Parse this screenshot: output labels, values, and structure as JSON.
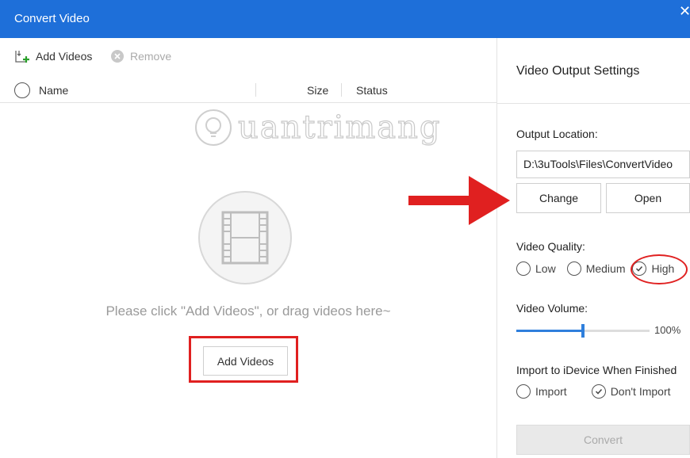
{
  "window": {
    "title": "Convert Video",
    "close_glyph": "✕"
  },
  "toolbar": {
    "add_videos_label": "Add Videos",
    "add_icon": "add-file-icon",
    "remove_label": "Remove",
    "remove_icon": "remove-circle-icon"
  },
  "table": {
    "columns": [
      "Name",
      "Size",
      "Status"
    ]
  },
  "watermark": {
    "text": "uantrimang"
  },
  "empty_state": {
    "icon": "film-strip-icon",
    "hint": "Please click \"Add Videos\", or drag videos here~",
    "add_button_label": "Add Videos"
  },
  "settings": {
    "title": "Video Output Settings",
    "output_location_label": "Output Location:",
    "output_path": "D:\\3uTools\\Files\\ConvertVideo",
    "change_label": "Change",
    "open_label": "Open",
    "video_quality_label": "Video Quality:",
    "quality_options": [
      "Low",
      "Medium",
      "High"
    ],
    "quality_selected": "High",
    "video_volume_label": "Video Volume:",
    "volume_percent": 50,
    "volume_value_text": "100%",
    "import_label": "Import to iDevice When Finished",
    "import_options": [
      "Import",
      "Don't Import"
    ],
    "import_selected": "Don't Import",
    "convert_label": "Convert"
  },
  "colors": {
    "titlebar": "#1e6fd9",
    "annotation_red": "#e02020",
    "slider_blue": "#2f7fdc"
  }
}
